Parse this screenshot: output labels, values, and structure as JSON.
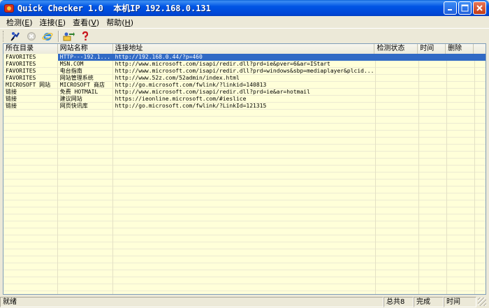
{
  "window": {
    "title": "Quick Checker 1.0  本机IP 192.168.0.131"
  },
  "menu": [
    {
      "label": "检测",
      "key": "E"
    },
    {
      "label": "连接",
      "key": "E"
    },
    {
      "label": "查看",
      "key": "V"
    },
    {
      "label": "帮助",
      "key": "H"
    }
  ],
  "toolbar": {
    "buttons": [
      {
        "icon": "run-check-icon"
      },
      {
        "icon": "stop-icon"
      },
      {
        "icon": "ie-browser-icon"
      },
      {
        "icon": "connect-icon"
      },
      {
        "icon": "help-icon"
      }
    ]
  },
  "table": {
    "columns": [
      "所在目录",
      "网站名称",
      "连接地址",
      "检测状态",
      "时间",
      "删除"
    ],
    "rows": [
      {
        "dir": "FAVORITES",
        "name": "HTTP---192.1...",
        "url": "http://192.168.0.44/?p=460",
        "status": "",
        "time": "",
        "del": "",
        "selected": true
      },
      {
        "dir": "FAVORITES",
        "name": "MSN.COM",
        "url": "http://www.microsoft.com/isapi/redir.dll?prd=ie&pver=6&ar=IStart",
        "status": "",
        "time": "",
        "del": ""
      },
      {
        "dir": "FAVORITES",
        "name": "电台指南",
        "url": "http://www.microsoft.com/isapi/redir.dll?prd=windows&sbp=mediaplayer&plcid...",
        "status": "",
        "time": "",
        "del": ""
      },
      {
        "dir": "FAVORITES",
        "name": "网站管理系统",
        "url": "http://www.52z.com/52admin/index.html",
        "status": "",
        "time": "",
        "del": ""
      },
      {
        "dir": "MICROSOFT 网站",
        "name": "MICROSOFT 商店",
        "url": "http://go.microsoft.com/fwlink/?linkid=140813",
        "status": "",
        "time": "",
        "del": ""
      },
      {
        "dir": "链接",
        "name": "免费 HOTMAIL",
        "url": "http://www.microsoft.com/isapi/redir.dll?prd=ie&ar=hotmail",
        "status": "",
        "time": "",
        "del": ""
      },
      {
        "dir": "链接",
        "name": "建议网站",
        "url": "https://ieonline.microsoft.com/#ieslice",
        "status": "",
        "time": "",
        "del": ""
      },
      {
        "dir": "链接",
        "name": "网页快讯库",
        "url": "http://go.microsoft.com/fwlink/?LinkId=121315",
        "status": "",
        "time": "",
        "del": ""
      }
    ]
  },
  "statusbar": {
    "ready": "就绪",
    "total": "总共8",
    "done": "完成",
    "time": "时间"
  },
  "colors": {
    "titlebar": "#0055e5",
    "list_bg": "#ffffd9",
    "selection": "#316ac5"
  }
}
